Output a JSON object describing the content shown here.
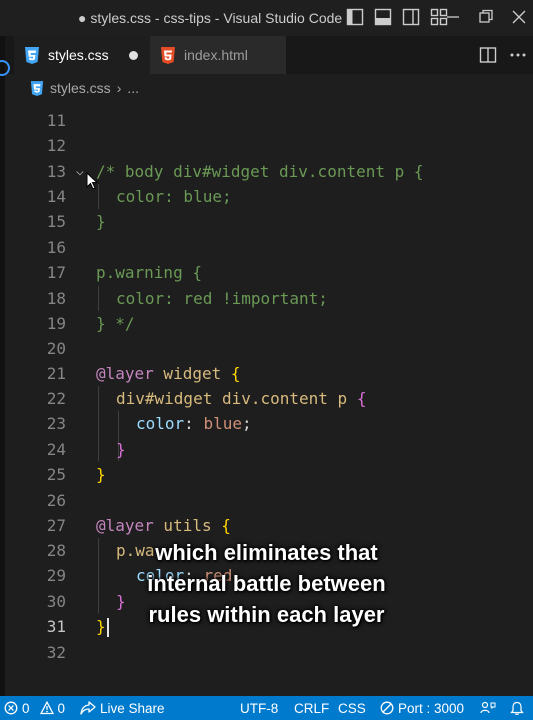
{
  "window": {
    "title": "● styles.css - css-tips - Visual Studio Code"
  },
  "tabs": [
    {
      "label": "styles.css",
      "icon": "css3-icon",
      "modified": true
    },
    {
      "label": "index.html",
      "icon": "html5-icon",
      "modified": false
    }
  ],
  "breadcrumb": {
    "file": "styles.css",
    "more": "..."
  },
  "editor": {
    "current_line": 31,
    "lines": [
      {
        "n": "11"
      },
      {
        "n": "12"
      },
      {
        "n": "13"
      },
      {
        "n": "14"
      },
      {
        "n": "15"
      },
      {
        "n": "16"
      },
      {
        "n": "17"
      },
      {
        "n": "18"
      },
      {
        "n": "19"
      },
      {
        "n": "20"
      },
      {
        "n": "21"
      },
      {
        "n": "22"
      },
      {
        "n": "23"
      },
      {
        "n": "24"
      },
      {
        "n": "25"
      },
      {
        "n": "26"
      },
      {
        "n": "27"
      },
      {
        "n": "28"
      },
      {
        "n": "29"
      },
      {
        "n": "30"
      },
      {
        "n": "31"
      },
      {
        "n": "32"
      }
    ],
    "code": {
      "l13": "/* body div#widget div.content p {",
      "l14": "color: blue;",
      "l15": "}",
      "l17": "p.warning {",
      "l18": "color: red !important;",
      "l19": "} */",
      "l21_at": "@layer",
      "l21_name": " widget",
      "l21_brace": " {",
      "l22_sel": "div#widget div.content p",
      "l22_brace": " {",
      "l23_prop": "color",
      "l23_colon": ": ",
      "l23_val": "blue",
      "l23_semi": ";",
      "l24": "}",
      "l25": "}",
      "l27_at": "@layer",
      "l27_name": " utils",
      "l27_brace": " {",
      "l28_sel": "p.wa",
      "l29_prop": "color",
      "l29_colon": ": ",
      "l29_val": "red",
      "l30": "}",
      "l31": "}"
    }
  },
  "caption": {
    "line1": "which eliminates that",
    "line2": "internal battle between",
    "line3": "rules within each layer"
  },
  "statusbar": {
    "errors": "0",
    "warnings": "0",
    "live_share": "Live Share",
    "encoding": "UTF-8",
    "eol": "CRLF",
    "language": "CSS",
    "port": "Port : 3000"
  },
  "colors": {
    "statusbar": "#007acc",
    "editor_bg": "#1e1e1e",
    "comment": "#6a9955",
    "selector": "#d7ba7d",
    "at_rule": "#c586c0"
  }
}
